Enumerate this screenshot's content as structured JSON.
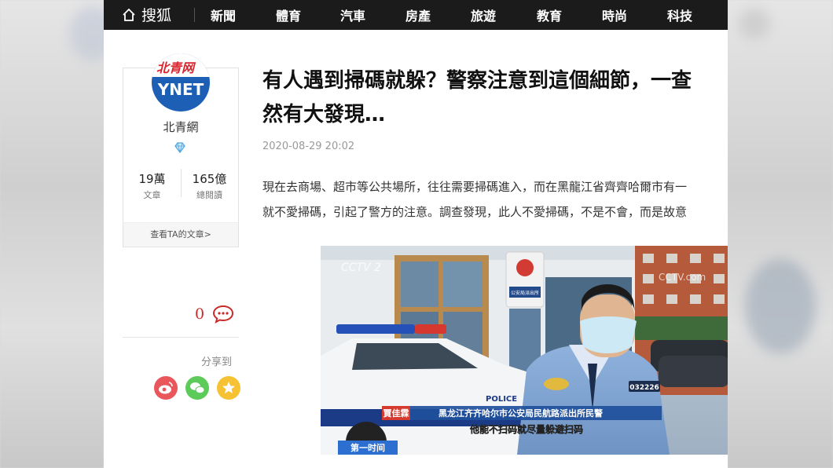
{
  "nav": {
    "brand": "搜狐",
    "items": [
      "新聞",
      "體育",
      "汽車",
      "房產",
      "旅遊",
      "教育",
      "時尚",
      "科技"
    ]
  },
  "author": {
    "logo_cn": "北青网",
    "logo_en": "YNET",
    "name": "北青網",
    "articles_count": "19萬",
    "articles_label": "文章",
    "reads_count": "165億",
    "reads_label": "總閱讀",
    "more_link": "查看TA的文章>"
  },
  "interaction": {
    "comment_count": "0",
    "share_label": "分享到"
  },
  "article": {
    "title_line1": "有人遇到掃碼就躲？警察注意到這個細節，一查",
    "title_line2": "然有大發現…",
    "date": "2020-08-29 20:02",
    "para_line1": "現在去商場、超市等公共場所，往往需要掃碼進入，而在黑龍江省齊齊哈爾市有一",
    "para_line2": "就不愛掃碼，引起了警方的注意。調查發現，此人不愛掃碼，不是不會，而是故意"
  },
  "video": {
    "channel_logo": "CCTV 2",
    "watermark": "CCTV.com",
    "station_sign": "公安局派出所",
    "badge_number": "032226",
    "person_name": "賈佳霖",
    "person_title": "黑龙江齐齐哈尔市公安局民航路派出所民警",
    "subtitle": "他能不扫码就尽量躲避扫码",
    "program": "第一时间",
    "car_text": "POLICE"
  },
  "colors": {
    "nav_bg": "#1b1b1b",
    "accent_red": "#c82a2a",
    "logo_blue": "#1d5fb5",
    "caption_blue": "#1e4f9c"
  }
}
